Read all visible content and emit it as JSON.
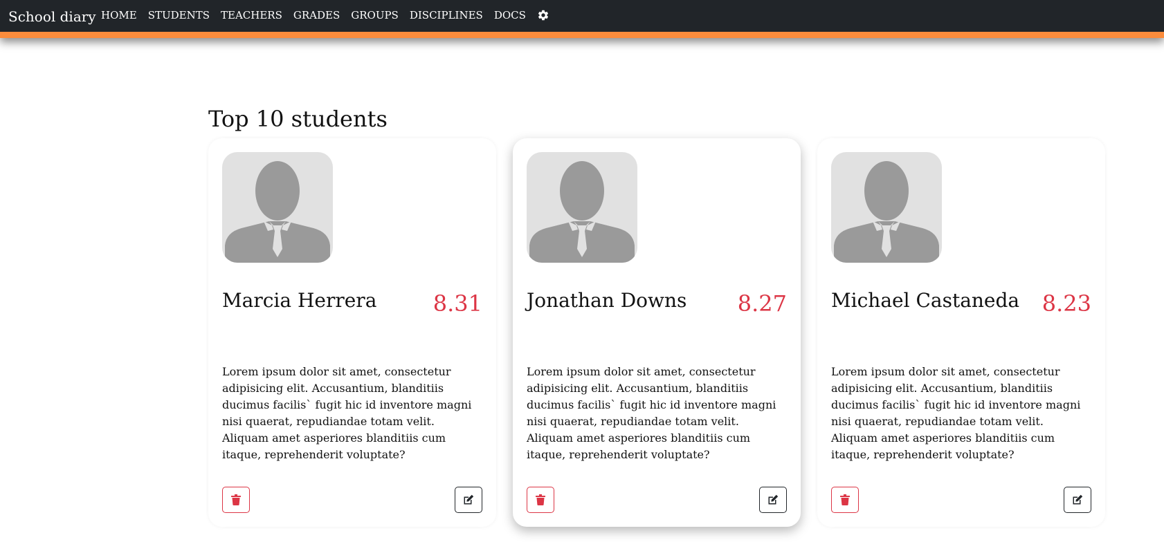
{
  "navbar": {
    "brand": "School diary",
    "links": [
      "HOME",
      "STUDENTS",
      "TEACHERS",
      "GRADES",
      "GROUPS",
      "DISCIPLINES",
      "DOCS"
    ],
    "settings_icon": "gear-icon"
  },
  "page_title": "Top 10 students",
  "students": [
    {
      "name": "Marcia Herrera",
      "grade": "8.31",
      "description": "Lorem ipsum dolor sit amet, consectetur adipisicing elit. Accusantium, blanditiis ducimus facilis` fugit hic id inventore magni nisi quaerat, repudiandae totam velit. Aliquam amet asperiores blanditiis cum itaque, reprehenderit voluptate?"
    },
    {
      "name": "Jonathan Downs",
      "grade": "8.27",
      "description": "Lorem ipsum dolor sit amet, consectetur adipisicing elit. Accusantium, blanditiis ducimus facilis` fugit hic id inventore magni nisi quaerat, repudiandae totam velit. Aliquam amet asperiores blanditiis cum itaque, reprehenderit voluptate?"
    },
    {
      "name": "Michael Castaneda",
      "grade": "8.23",
      "description": "Lorem ipsum dolor sit amet, consectetur adipisicing elit. Accusantium, blanditiis ducimus facilis` fugit hic id inventore magni nisi quaerat, repudiandae totam velit. Aliquam amet asperiores blanditiis cum itaque, reprehenderit voluptate?"
    }
  ],
  "icons": {
    "avatar": "person-placeholder-icon",
    "delete": "trash-icon",
    "edit": "edit-icon"
  },
  "colors": {
    "navbar_bg": "#212529",
    "accent_orange": "#fb8c3c",
    "grade_red": "#dc3545"
  }
}
